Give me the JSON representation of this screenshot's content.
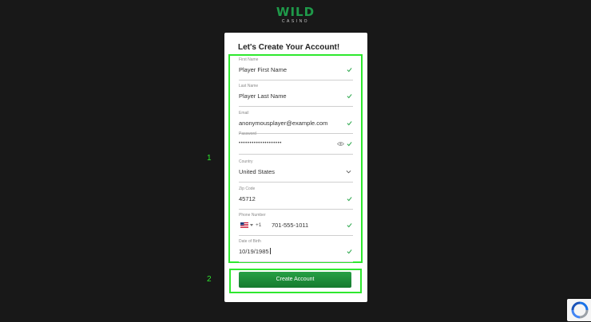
{
  "logo": {
    "main": "WILD",
    "sub": "CASINO"
  },
  "form": {
    "title": "Let's Create Your Account!",
    "fields": {
      "first_name": {
        "label": "First Name",
        "value": "Player First Name"
      },
      "last_name": {
        "label": "Last Name",
        "value": "Player Last Name"
      },
      "email": {
        "label": "Email",
        "value": "anonymousplayer@example.com"
      },
      "password": {
        "label": "Password",
        "masked": "••••••••••••••••••••"
      },
      "country": {
        "label": "Country",
        "value": "United States"
      },
      "zip": {
        "label": "Zip Code",
        "value": "45712"
      },
      "phone": {
        "label": "Phone Number",
        "dial_code": "+1",
        "value": "701-555-1011"
      },
      "dob": {
        "label": "Date of Birth",
        "value": "10/19/1985"
      }
    },
    "submit_label": "Create Account"
  },
  "annotations": {
    "form_number": "1",
    "button_number": "2"
  },
  "colors": {
    "brand_green": "#1f9a4a",
    "highlight": "#2ee82e",
    "check": "#2fa84f",
    "background": "#181818"
  },
  "icons": [
    "checkmark-icon",
    "eye-icon",
    "chevron-down-icon",
    "us-flag-icon",
    "recaptcha-icon"
  ]
}
